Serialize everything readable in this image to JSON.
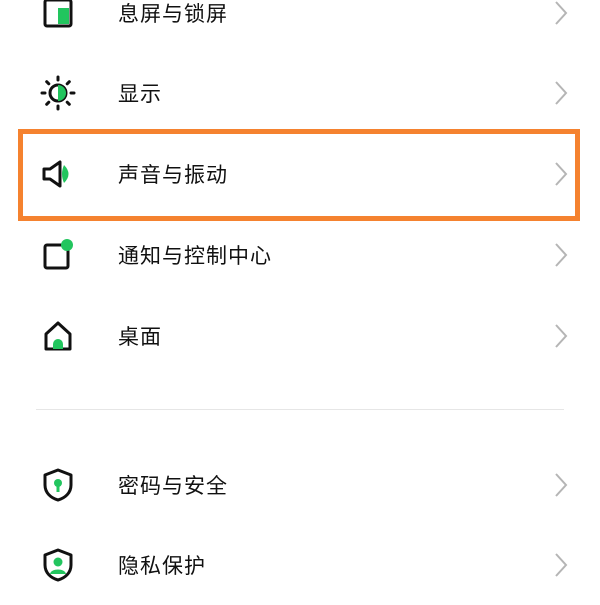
{
  "settings": {
    "items": [
      {
        "label": "息屏与锁屏",
        "icon": "lock-screen-icon"
      },
      {
        "label": "显示",
        "icon": "brightness-icon"
      },
      {
        "label": "声音与振动",
        "icon": "speaker-icon"
      },
      {
        "label": "通知与控制中心",
        "icon": "notification-icon"
      },
      {
        "label": "桌面",
        "icon": "home-icon"
      },
      {
        "label": "密码与安全",
        "icon": "shield-icon"
      },
      {
        "label": "隐私保护",
        "icon": "privacy-icon"
      }
    ]
  },
  "colors": {
    "accent": "#22c55e",
    "highlight": "#f5822f",
    "text": "#111111",
    "chevron": "#b5b5b5"
  },
  "highlighted_item": "声音与振动"
}
